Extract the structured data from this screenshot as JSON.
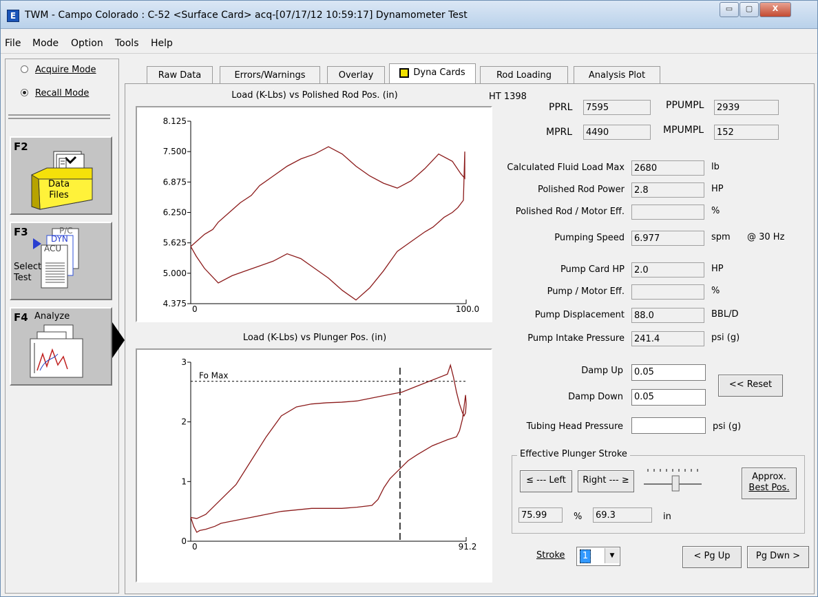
{
  "window": {
    "title": "TWM  -  Campo Colorado : C-52  <Surface Card>  acq-[07/17/12 10:59:17]  Dynamometer Test",
    "app_icon": "app-e-icon",
    "caption_minimize": "▭",
    "caption_maximize": "▢",
    "caption_close": "X"
  },
  "menu": [
    "File",
    "Mode",
    "Option",
    "Tools",
    "Help"
  ],
  "left_panel": {
    "modes": [
      {
        "label": "Acquire Mode",
        "selected": false
      },
      {
        "label": "Recall Mode",
        "selected": true
      }
    ],
    "fkeys": [
      {
        "key": "F2",
        "caption": "Data\nFiles",
        "icon": "data-files-icon"
      },
      {
        "key": "F3",
        "caption": "Select\nTest",
        "icon": "select-test-icon",
        "docs": [
          "P/C",
          "DYN",
          "ACU"
        ]
      },
      {
        "key": "F4",
        "caption": "Analyze",
        "icon": "analyze-icon"
      }
    ]
  },
  "tabs": [
    {
      "label": "Raw Data",
      "active": false
    },
    {
      "label": "Errors/Warnings",
      "active": false
    },
    {
      "label": "Overlay",
      "active": false
    },
    {
      "label": "Dyna Cards",
      "active": true
    },
    {
      "label": "Rod Loading",
      "active": false
    },
    {
      "label": "Analysis Plot",
      "active": false
    }
  ],
  "chart_data": [
    {
      "type": "line",
      "title": "Load (K-Lbs) vs Polished Rod Pos. (in)",
      "xlim": [
        0,
        100.0
      ],
      "ylim": [
        4.375,
        8.125
      ],
      "x_ticks": [
        "0",
        "100.0"
      ],
      "y_ticks": [
        "8.125",
        "7.500",
        "6.875",
        "6.250",
        "5.625",
        "5.000",
        "4.375"
      ],
      "series": [
        {
          "color": "#8b1a1a",
          "x": [
            0,
            2,
            5,
            10,
            15,
            20,
            25,
            30,
            35,
            40,
            45,
            50,
            55,
            60,
            65,
            70,
            75,
            80,
            85,
            88,
            90,
            92,
            95,
            97,
            99,
            99.5,
            99.5,
            98,
            95,
            90,
            85,
            80,
            75,
            70,
            65,
            60,
            55,
            50,
            45,
            40,
            35,
            30,
            25,
            22,
            18,
            15,
            10,
            8,
            5,
            3,
            0
          ],
          "y": [
            5.55,
            5.35,
            5.1,
            4.8,
            4.95,
            5.05,
            5.15,
            5.25,
            5.4,
            5.3,
            5.1,
            4.9,
            4.65,
            4.45,
            4.7,
            5.05,
            5.45,
            5.65,
            5.85,
            5.95,
            6.05,
            6.15,
            6.25,
            6.35,
            6.5,
            7.5,
            6.95,
            7.05,
            7.3,
            7.45,
            7.15,
            6.9,
            6.75,
            6.85,
            7.0,
            7.2,
            7.45,
            7.6,
            7.45,
            7.35,
            7.2,
            7.0,
            6.8,
            6.6,
            6.45,
            6.3,
            6.05,
            5.9,
            5.8,
            5.7,
            5.55
          ]
        }
      ]
    },
    {
      "type": "line",
      "title": "Load (K-Lbs) vs Plunger Pos. (in)",
      "xlim": [
        0,
        91.2
      ],
      "ylim": [
        0,
        3
      ],
      "x_ticks": [
        "0",
        "91.2"
      ],
      "y_ticks": [
        "3",
        "2",
        "1",
        "0"
      ],
      "reference_line_label": "Fo Max",
      "reference_line_y": 2.68,
      "stroke_marker_x": 69.3,
      "series": [
        {
          "color": "#8b1a1a",
          "x": [
            0,
            1,
            2,
            3,
            5,
            8,
            10,
            15,
            20,
            25,
            30,
            40,
            50,
            55,
            60,
            62,
            64,
            66,
            68,
            70,
            72,
            75,
            80,
            85,
            88,
            89,
            90,
            90.5,
            91,
            91.2,
            91,
            90.5,
            90,
            89,
            88,
            87,
            86,
            85,
            80,
            75,
            70,
            65,
            60,
            55,
            50,
            45,
            40,
            35,
            30,
            25,
            20,
            15,
            10,
            5,
            2,
            0
          ],
          "y": [
            0.4,
            0.25,
            0.15,
            0.18,
            0.2,
            0.25,
            0.3,
            0.35,
            0.4,
            0.45,
            0.5,
            0.55,
            0.55,
            0.57,
            0.6,
            0.7,
            0.9,
            1.05,
            1.15,
            1.25,
            1.35,
            1.45,
            1.6,
            1.7,
            1.75,
            1.85,
            2.05,
            2.25,
            2.45,
            2.3,
            2.15,
            2.1,
            2.15,
            2.3,
            2.5,
            2.75,
            2.95,
            2.8,
            2.7,
            2.6,
            2.5,
            2.45,
            2.4,
            2.35,
            2.33,
            2.32,
            2.3,
            2.25,
            2.1,
            1.75,
            1.35,
            0.95,
            0.7,
            0.45,
            0.38,
            0.4
          ]
        }
      ]
    }
  ],
  "readouts": {
    "well_id": "HT 1398",
    "pprl": {
      "label": "PPRL",
      "value": "7595"
    },
    "ppumpl": {
      "label": "PPUMPL",
      "value": "2939"
    },
    "mprl": {
      "label": "MPRL",
      "value": "4490"
    },
    "mpumpl": {
      "label": "MPUMPL",
      "value": "152"
    },
    "rows": [
      {
        "label": "Calculated Fluid Load Max",
        "value": "2680",
        "unit": "lb"
      },
      {
        "label": "Polished Rod Power",
        "value": "2.8",
        "unit": "HP"
      },
      {
        "label": "Polished Rod / Motor Eff.",
        "value": "",
        "unit": "%"
      },
      {
        "label": "Pumping Speed",
        "value": "6.977",
        "unit": "spm",
        "extra": "@ 30 Hz"
      },
      {
        "label": "Pump Card HP",
        "value": "2.0",
        "unit": "HP"
      },
      {
        "label": "Pump / Motor Eff.",
        "value": "",
        "unit": "%"
      },
      {
        "label": "Pump Displacement",
        "value": "88.0",
        "unit": "BBL/D"
      },
      {
        "label": "Pump Intake Pressure",
        "value": "241.4",
        "unit": "psi (g)"
      }
    ]
  },
  "damp": {
    "up_label": "Damp Up",
    "up_value": "0.05",
    "down_label": "Damp Down",
    "down_value": "0.05",
    "reset_label": "<< Reset"
  },
  "tubing": {
    "label": "Tubing Head Pressure",
    "value": "",
    "unit": "psi (g)"
  },
  "eps": {
    "title": "Effective Plunger Stroke",
    "left_label": "≤ --- Left",
    "right_label": "Right --- ≥",
    "best_label_1": "Approx.",
    "best_label_2": "Best Pos.",
    "percent_value": "75.99",
    "percent_unit": "%",
    "inch_value": "69.3",
    "inch_unit": "in",
    "slider_level": 0.55
  },
  "stroke": {
    "label": "Stroke",
    "value": "1"
  },
  "paging": {
    "up": "< Pg Up",
    "down": "Pg Dwn >"
  }
}
